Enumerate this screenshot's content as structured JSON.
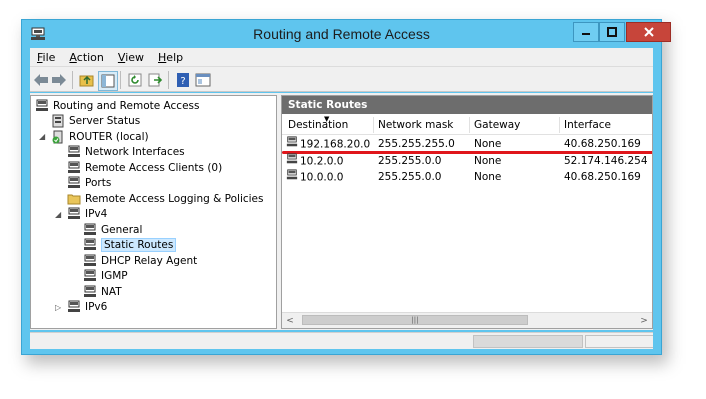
{
  "window": {
    "title": "Routing and Remote Access",
    "controls": {
      "minimize": "minimize-icon",
      "maximize": "maximize-icon",
      "close": "close-icon"
    }
  },
  "menu": {
    "items": [
      {
        "label": "File",
        "key": "F",
        "rest": "ile"
      },
      {
        "label": "Action",
        "key": "A",
        "rest": "ction"
      },
      {
        "label": "View",
        "key": "V",
        "rest": "iew"
      },
      {
        "label": "Help",
        "key": "H",
        "rest": "elp"
      }
    ]
  },
  "toolbar": {
    "icons": [
      "back-arrow-icon",
      "forward-arrow-icon",
      "up-folder-icon",
      "show-hide-tree-icon",
      "refresh-icon",
      "export-list-icon",
      "help-icon",
      "properties-icon"
    ]
  },
  "tree": {
    "root": "Routing and Remote Access",
    "server_status": "Server Status",
    "router": "ROUTER (local)",
    "network_interfaces": "Network Interfaces",
    "remote_access_clients": "Remote Access Clients (0)",
    "ports": "Ports",
    "logging_policies": "Remote Access Logging & Policies",
    "ipv4": "IPv4",
    "general": "General",
    "static_routes": "Static Routes",
    "dhcp_relay": "DHCP Relay Agent",
    "igmp": "IGMP",
    "nat": "NAT",
    "ipv6": "IPv6"
  },
  "pane": {
    "title": "Static Routes",
    "columns": [
      "Destination",
      "Network mask",
      "Gateway",
      "Interface"
    ],
    "rows": [
      [
        "192.168.20.0",
        "255.255.255.0",
        "None",
        "40.68.250.169"
      ],
      [
        "10.2.0.0",
        "255.255.0.0",
        "None",
        "52.174.146.254"
      ],
      [
        "10.0.0.0",
        "255.255.0.0",
        "None",
        "40.68.250.169"
      ]
    ]
  },
  "colors": {
    "title_bar": "#5fc5ee",
    "close_button": "#c7453a",
    "pane_header": "#6d6d6d",
    "selection": "#cce8ff",
    "annotation_line": "#e0161b"
  }
}
